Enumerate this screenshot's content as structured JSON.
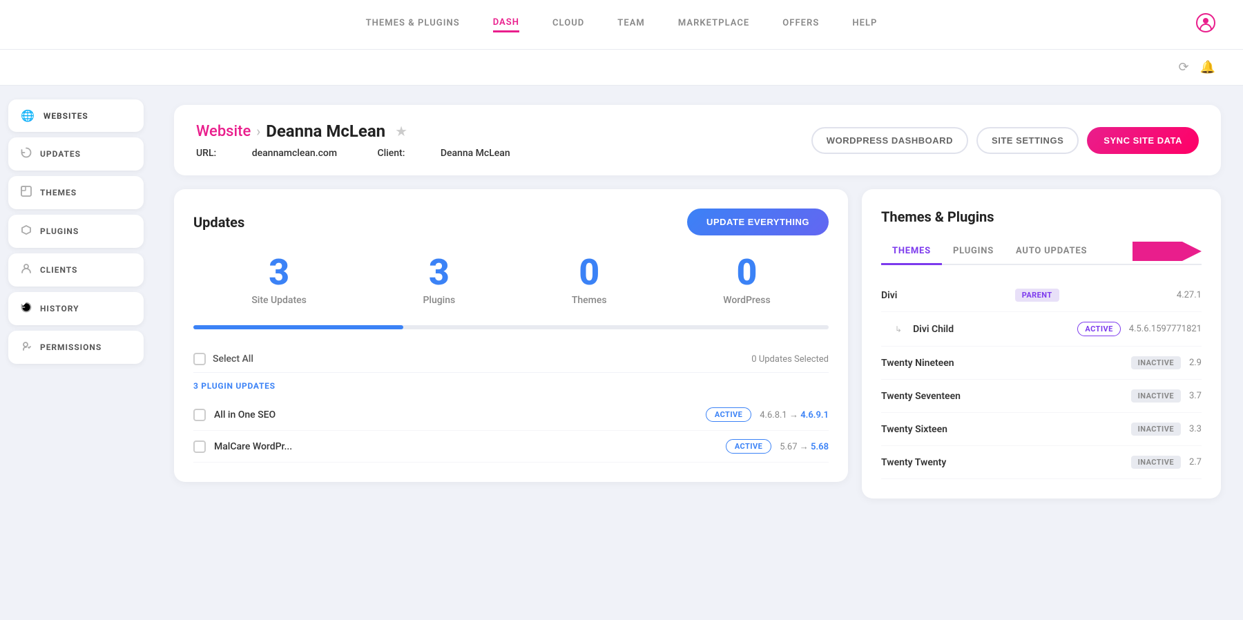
{
  "nav": {
    "links": [
      {
        "id": "themes-plugins",
        "label": "THEMES & PLUGINS",
        "active": false
      },
      {
        "id": "dash",
        "label": "DASH",
        "active": true
      },
      {
        "id": "cloud",
        "label": "CLOUD",
        "active": false
      },
      {
        "id": "team",
        "label": "TEAM",
        "active": false
      },
      {
        "id": "marketplace",
        "label": "MARKETPLACE",
        "active": false
      },
      {
        "id": "offers",
        "label": "OFFERS",
        "active": false
      },
      {
        "id": "help",
        "label": "HELP",
        "active": false
      }
    ],
    "user_icon": "👤"
  },
  "sidebar": {
    "items": [
      {
        "id": "websites",
        "label": "WEBSITES",
        "icon": "🌐",
        "active": true
      },
      {
        "id": "updates",
        "label": "UPDATES",
        "icon": "🔄",
        "active": false
      },
      {
        "id": "themes",
        "label": "THEMES",
        "icon": "⬛",
        "active": false
      },
      {
        "id": "plugins",
        "label": "PLUGINS",
        "icon": "🛡",
        "active": false
      },
      {
        "id": "clients",
        "label": "CLIENTS",
        "icon": "👤",
        "active": false
      },
      {
        "id": "history",
        "label": "HISTORY",
        "icon": "🔄",
        "active": false
      },
      {
        "id": "permissions",
        "label": "PERMISSIONS",
        "icon": "🔑",
        "active": false
      }
    ]
  },
  "page": {
    "breadcrumb": "Website",
    "separator": "›",
    "site_name": "Deanna McLean",
    "url_label": "URL:",
    "url_value": "deannamclean.com",
    "client_label": "Client:",
    "client_value": "Deanna McLean",
    "actions": {
      "wordpress_dashboard": "WORDPRESS DASHBOARD",
      "site_settings": "SITE SETTINGS",
      "sync_site_data": "SYNC SITE DATA"
    }
  },
  "updates": {
    "title": "Updates",
    "update_everything_btn": "UPDATE EVERYTHING",
    "stats": [
      {
        "number": "3",
        "label": "Site Updates"
      },
      {
        "number": "3",
        "label": "Plugins"
      },
      {
        "number": "0",
        "label": "Themes"
      },
      {
        "number": "0",
        "label": "WordPress"
      }
    ],
    "select_all_label": "Select All",
    "updates_selected": "0 Updates Selected",
    "plugin_updates_label": "3 PLUGIN UPDATES",
    "plugins": [
      {
        "name": "All in One SEO",
        "badge": "ACTIVE",
        "version_from": "4.6.8.1",
        "version_to": "4.6.9.1"
      },
      {
        "name": "MalCare WordPr...",
        "badge": "ACTIVE",
        "version_from": "5.67",
        "version_to": "5.68"
      }
    ]
  },
  "themes_plugins": {
    "title": "Themes & Plugins",
    "tabs": [
      {
        "id": "themes",
        "label": "THEMES",
        "active": true
      },
      {
        "id": "plugins",
        "label": "PLUGINS",
        "active": false
      },
      {
        "id": "auto_updates",
        "label": "AUTO UPDATES",
        "active": false
      }
    ],
    "themes": [
      {
        "name": "Divi",
        "badge_type": "parent",
        "badge_label": "PARENT",
        "version": "4.27.1",
        "sub": false
      },
      {
        "name": "Divi Child",
        "badge_type": "active",
        "badge_label": "ACTIVE",
        "version": "4.5.6.1597771821",
        "sub": true
      },
      {
        "name": "Twenty Nineteen",
        "badge_type": "inactive",
        "badge_label": "INACTIVE",
        "version": "2.9",
        "sub": false
      },
      {
        "name": "Twenty Seventeen",
        "badge_type": "inactive",
        "badge_label": "INACTIVE",
        "version": "3.7",
        "sub": false
      },
      {
        "name": "Twenty Sixteen",
        "badge_type": "inactive",
        "badge_label": "INACTIVE",
        "version": "3.3",
        "sub": false
      },
      {
        "name": "Twenty Twenty",
        "badge_type": "inactive",
        "badge_label": "INACTIVE",
        "version": "2.7",
        "sub": false
      }
    ]
  }
}
